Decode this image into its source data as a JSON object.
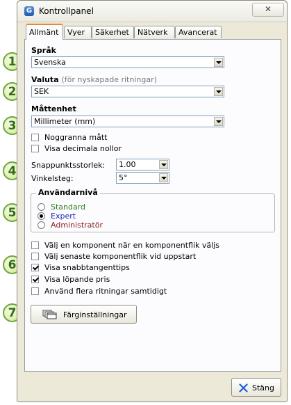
{
  "window": {
    "title": "Kontrollpanel",
    "close_glyph": "✕"
  },
  "tabs": [
    {
      "label": "Allmänt",
      "active": true
    },
    {
      "label": "Vyer",
      "active": false
    },
    {
      "label": "Säkerhet",
      "active": false
    },
    {
      "label": "Nätverk",
      "active": false
    },
    {
      "label": "Avancerat",
      "active": false
    }
  ],
  "callouts": [
    "1",
    "2",
    "3",
    "4",
    "5",
    "6",
    "7"
  ],
  "language": {
    "label": "Språk",
    "value": "Svenska"
  },
  "currency": {
    "label": "Valuta",
    "hint": "(för nyskapade ritningar)",
    "value": "SEK"
  },
  "unit": {
    "label": "Måttenhet",
    "value": "Millimeter (mm)"
  },
  "unit_options": [
    {
      "label": "Noggranna mått",
      "checked": false
    },
    {
      "label": "Visa decimala nollor",
      "checked": false
    }
  ],
  "snap": {
    "label": "Snappunktsstorlek:",
    "value": "1.00"
  },
  "angle": {
    "label": "Vinkelsteg:",
    "value": "5°"
  },
  "user_level": {
    "title": "Användarnivå",
    "options": [
      {
        "label": "Standard",
        "selected": false,
        "color": "#2e7d1e"
      },
      {
        "label": "Expert",
        "selected": true,
        "color": "#1a2bb8"
      },
      {
        "label": "Administratör",
        "selected": false,
        "color": "#8b1c1c"
      }
    ]
  },
  "options": [
    {
      "label": "Välj en komponent när en komponentflik väljs",
      "checked": false
    },
    {
      "label": "Välj senaste komponentflik vid uppstart",
      "checked": false
    },
    {
      "label": "Visa snabbtangenttips",
      "checked": true
    },
    {
      "label": "Visa löpande pris",
      "checked": true
    },
    {
      "label": "Använd flera ritningar samtidigt",
      "checked": false
    }
  ],
  "color_settings_button": {
    "label": "Färginställningar",
    "icon": "palette-windows-icon"
  },
  "close_button": {
    "label": "Stäng",
    "icon": "x-icon"
  },
  "colors": {
    "accent_tab": "#e68b2c",
    "callout_border": "#69a83e",
    "close_x": "#1b5fcf"
  }
}
